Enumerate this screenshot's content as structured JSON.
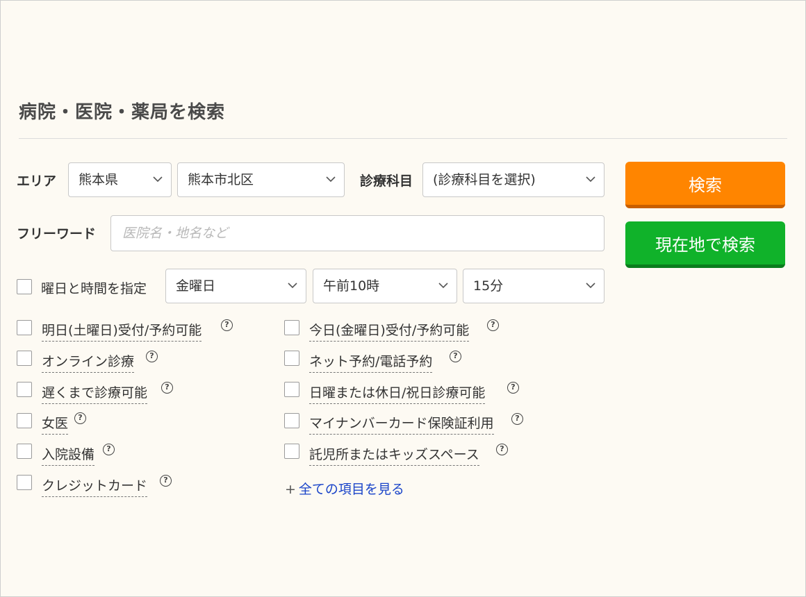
{
  "header": {
    "title": "病院・医院・薬局を検索"
  },
  "area": {
    "label": "エリア",
    "prefecture": "熊本県",
    "city": "熊本市北区"
  },
  "department": {
    "label": "診療科目",
    "value": "(診療科目を選択)"
  },
  "freeword": {
    "label": "フリーワード",
    "placeholder": "医院名・地名など",
    "value": ""
  },
  "buttons": {
    "search": "検索",
    "search_current_location": "現在地で検索"
  },
  "colors": {
    "search_button": "#ff8500",
    "location_button": "#10b22a",
    "link": "#1a44c9"
  },
  "schedule": {
    "label": "曜日と時間を指定",
    "day": "金曜日",
    "hour": "午前10時",
    "minute": "15分"
  },
  "options_left": [
    {
      "label": "明日(土曜日)受付/予約可能"
    },
    {
      "label": "オンライン診療"
    },
    {
      "label": "遅くまで診療可能"
    },
    {
      "label": "女医"
    },
    {
      "label": "入院設備"
    },
    {
      "label": "クレジットカード"
    }
  ],
  "options_right": [
    {
      "label": "今日(金曜日)受付/予約可能"
    },
    {
      "label": "ネット予約/電話予約"
    },
    {
      "label": "日曜または休日/祝日診療可能"
    },
    {
      "label": "マイナンバーカード保険証利用"
    },
    {
      "label": "託児所またはキッズスペース"
    }
  ],
  "more_link": {
    "plus": "+",
    "label": "全ての項目を見る"
  },
  "icons": {
    "help": "question-circle-icon",
    "chevron": "chevron-down-icon"
  }
}
